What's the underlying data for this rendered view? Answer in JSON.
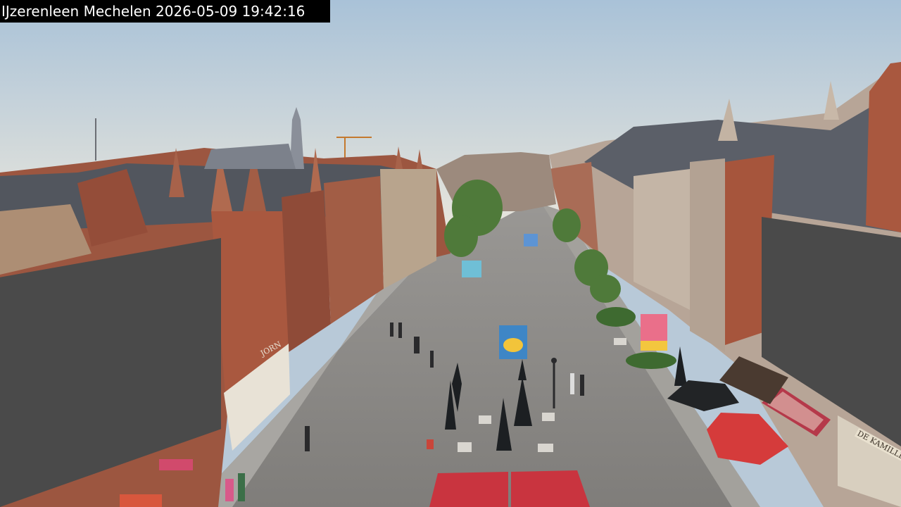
{
  "camera": {
    "overlay_text": "IJzerenleen Mechelen 2026-05-09 19:42:16",
    "location": "IJzerenleen Mechelen",
    "date": "2026-05-09",
    "time": "19:42:16"
  },
  "scene": {
    "description_icons": [
      "street-icon",
      "building-icon",
      "umbrella-icon",
      "tree-icon",
      "pedestrian-icon"
    ],
    "colors": {
      "sky_top": "#a9c2d8",
      "sky_bottom": "#e6e4da",
      "pavement": "#8d8b88",
      "brick": "#a9583f",
      "roof": "#4a4f58",
      "mask": "#4a4a4a",
      "umbrella_red": "#c9343f",
      "tree_green": "#4f7a3a"
    },
    "privacy_masks": [
      "left",
      "right"
    ]
  },
  "shop_signs": {
    "left": "JORN",
    "right": "DE KAMILLE"
  }
}
